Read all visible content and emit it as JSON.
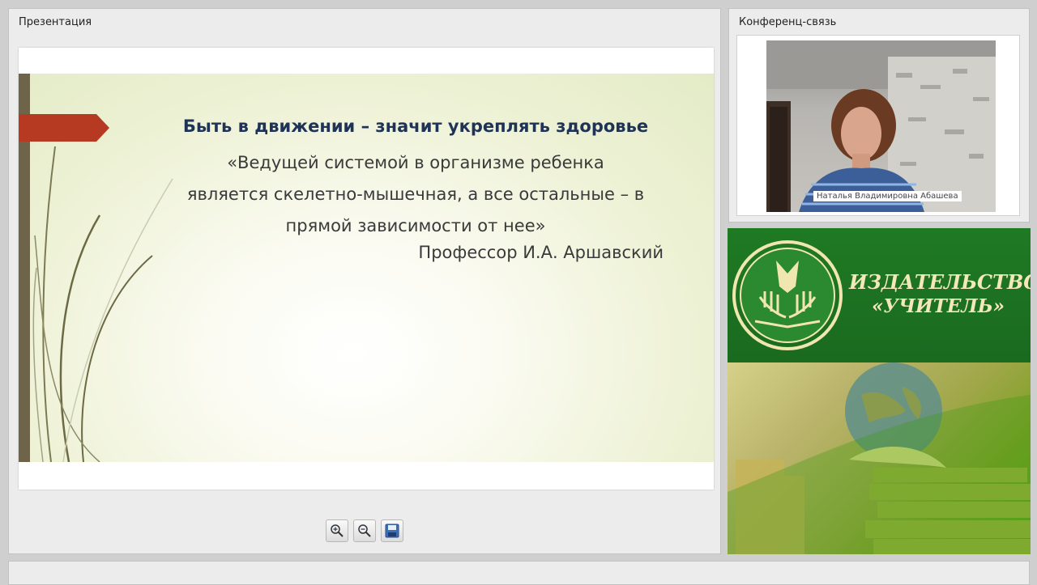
{
  "presentation_panel": {
    "title": "Презентация",
    "slide": {
      "heading": "Быть в движении – значит укреплять здоровье",
      "quote_lines": [
        "«Ведущей системой в организме ребенка",
        "является скелетно-мышечная, а все остальные – в",
        "прямой зависимости от нее»"
      ],
      "author": "Профессор И.А. Аршавский"
    },
    "toolbar": {
      "zoom_in_icon": "magnifier-plus-icon",
      "zoom_out_icon": "magnifier-minus-icon",
      "save_icon": "floppy-disk-icon"
    }
  },
  "conference_panel": {
    "title": "Конференц-связь",
    "participant_name": "Наталья Владимировна Абашева"
  },
  "publisher_banner": {
    "line1": "ИЗДАТЕЛЬСТВО",
    "line2": "«УЧИТЕЛЬ»",
    "logo_icon": "open-book-emblem-icon"
  },
  "colors": {
    "slide_heading": "#1f3357",
    "slide_text": "#3a3a3a",
    "slide_accent_arrow": "#b63a22",
    "banner_green": "#1f7a24",
    "banner_text": "#f4e8b8"
  }
}
